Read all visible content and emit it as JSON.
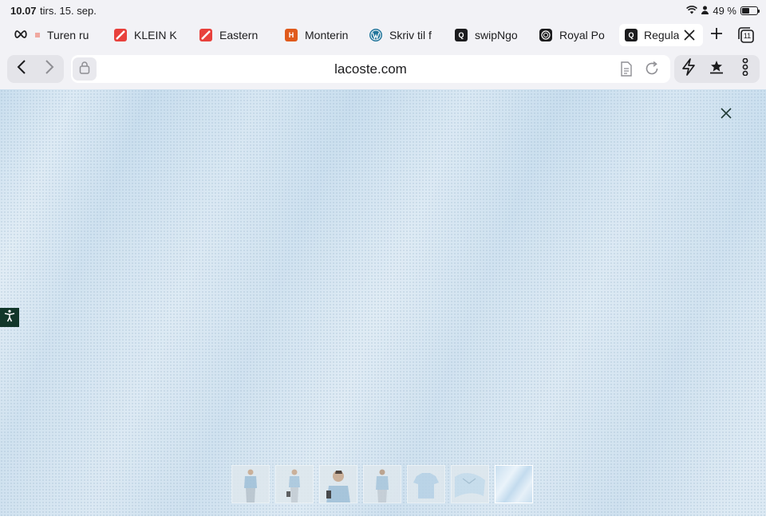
{
  "status": {
    "time": "10.07",
    "date": "tirs. 15. sep.",
    "battery": "49 %",
    "battery_level": 0.49
  },
  "tabs": [
    {
      "label": "Turen ru",
      "icon": "infinity-icon"
    },
    {
      "label": "KLEIN K",
      "icon": "klein-logo-icon"
    },
    {
      "label": "Eastern",
      "icon": "eastern-logo-icon"
    },
    {
      "label": "Monterin",
      "icon": "h-logo-icon",
      "icon_text": "H"
    },
    {
      "label": "Skriv til f",
      "icon": "wordpress-icon"
    },
    {
      "label": "swipNgo",
      "icon": "q-logo-icon",
      "icon_text": "Q"
    },
    {
      "label": "Royal Po",
      "icon": "royal-logo-icon"
    },
    {
      "label": "Regular",
      "icon": "q-logo-icon",
      "icon_text": "Q",
      "active": true
    }
  ],
  "tab_count": "11",
  "toolbar": {
    "url": "lacoste.com"
  },
  "viewer": {
    "thumbnails": [
      {
        "name": "product-thumb-1"
      },
      {
        "name": "product-thumb-2"
      },
      {
        "name": "product-thumb-3"
      },
      {
        "name": "product-thumb-4"
      },
      {
        "name": "product-thumb-5"
      },
      {
        "name": "product-thumb-6"
      },
      {
        "name": "product-thumb-7",
        "selected": true
      }
    ]
  },
  "colors": {
    "chrome": "#f2f2f6",
    "fabric": "#cfe1ef",
    "accessibility": "#12372a",
    "monterin": "#e05a1c",
    "klein": "#e8413c",
    "wordpress": "#21759b"
  }
}
